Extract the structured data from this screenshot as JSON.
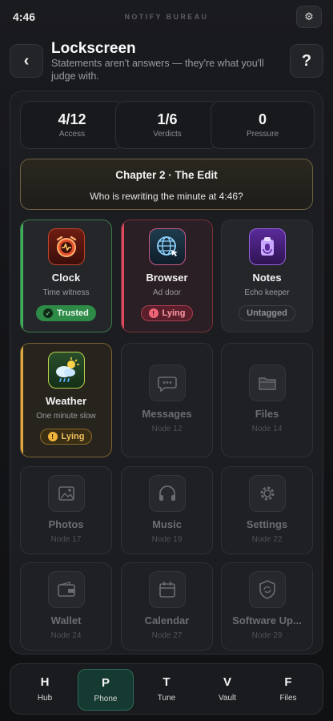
{
  "status_bar": {
    "time": "4:46",
    "app_name": "NOTIFY BUREAU",
    "settings_icon": "gear-icon"
  },
  "header": {
    "back_label": "‹",
    "title": "Lockscreen",
    "subtitle": "Statements aren't answers — they're what you'll judge with.",
    "help_label": "?"
  },
  "stats": [
    {
      "value": "4/12",
      "label": "Access"
    },
    {
      "value": "1/6",
      "label": "Verdicts"
    },
    {
      "value": "0",
      "label": "Pressure"
    }
  ],
  "chapter": {
    "title": "Chapter 2 · The Edit",
    "question": "Who is rewriting the minute at 4:46?"
  },
  "apps": [
    {
      "name": "Clock",
      "sub": "Time witness",
      "badge": "Trusted",
      "status": "trusted",
      "icon": "alarm-clock-icon",
      "accent": "#2f9a52"
    },
    {
      "name": "Browser",
      "sub": "Ad door",
      "badge": "Lying",
      "status": "lying",
      "icon": "globe-icon",
      "accent": "#e04a5f"
    },
    {
      "name": "Notes",
      "sub": "Echo keeper",
      "badge": "Untagged",
      "status": "untagged",
      "icon": "notes-icon",
      "accent": "#8a4ad6"
    },
    {
      "name": "Weather",
      "sub": "One minute slow",
      "badge": "Lying",
      "status": "lying-amber",
      "icon": "weather-icon",
      "accent": "#e0a83c"
    },
    {
      "name": "Messages",
      "sub": "Node 12",
      "status": "locked",
      "icon": "chat-bubble-icon"
    },
    {
      "name": "Files",
      "sub": "Node 14",
      "status": "locked",
      "icon": "folder-icon"
    },
    {
      "name": "Photos",
      "sub": "Node 17",
      "status": "locked",
      "icon": "photos-icon"
    },
    {
      "name": "Music",
      "sub": "Node 19",
      "status": "locked",
      "icon": "headphones-icon"
    },
    {
      "name": "Settings",
      "sub": "Node 22",
      "status": "locked",
      "icon": "settings-gear-icon"
    },
    {
      "name": "Wallet",
      "sub": "Node 24",
      "status": "locked",
      "icon": "wallet-icon"
    },
    {
      "name": "Calendar",
      "sub": "Node 27",
      "status": "locked",
      "icon": "calendar-icon"
    },
    {
      "name": "Software Up...",
      "sub": "Node 29",
      "status": "locked",
      "icon": "update-shield-icon"
    }
  ],
  "nav": [
    {
      "key": "H",
      "label": "Hub"
    },
    {
      "key": "P",
      "label": "Phone",
      "active": true
    },
    {
      "key": "T",
      "label": "Tune"
    },
    {
      "key": "V",
      "label": "Vault"
    },
    {
      "key": "F",
      "label": "Files"
    }
  ]
}
